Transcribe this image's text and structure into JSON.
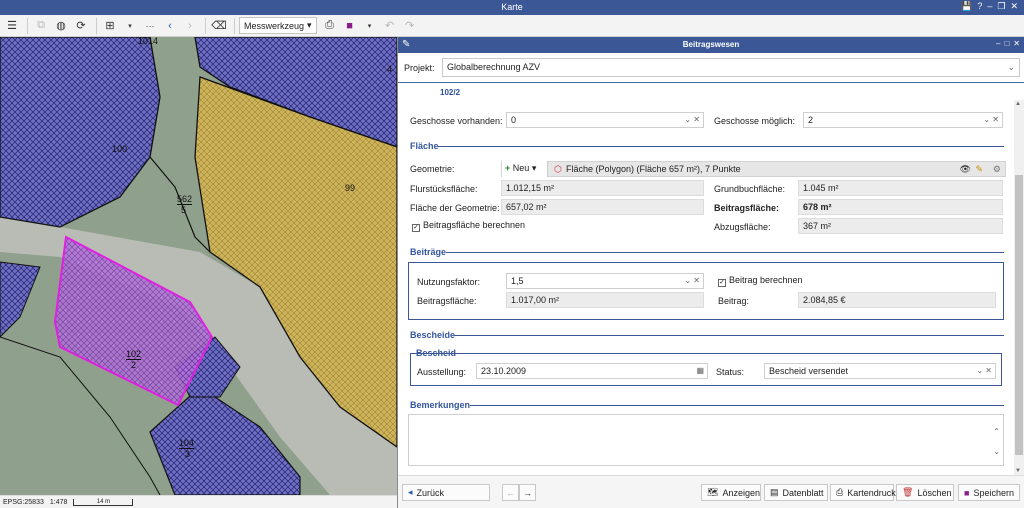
{
  "window": {
    "title": "Karte",
    "controls": [
      "💾",
      "?",
      "–",
      "❐",
      "✕"
    ]
  },
  "toolbar": {
    "measure_tool": "Messwerkzeug",
    "more": "···"
  },
  "map": {
    "parcels": [
      {
        "id": "1014",
        "label": "1014"
      },
      {
        "id": "100",
        "label": "100"
      },
      {
        "id": "562-5",
        "label": "562",
        "sub": "5"
      },
      {
        "id": "99",
        "label": "99"
      },
      {
        "id": "102-2",
        "label": "102",
        "sub": "2"
      },
      {
        "id": "104-3",
        "label": "104",
        "sub": "3"
      },
      {
        "id": "4",
        "label": "4"
      }
    ]
  },
  "statusbar": {
    "crs": "EPSG:25833",
    "scale": "1:478",
    "scalebar": "14 m"
  },
  "panel": {
    "title": "Beitragswesen",
    "project_label": "Projekt:",
    "project_value": "Globalberechnung AZV",
    "tab": "102/2",
    "geschosse_vorhanden_label": "Geschosse vorhanden:",
    "geschosse_vorhanden_value": "0",
    "geschosse_moeglich_label": "Geschosse möglich:",
    "geschosse_moeglich_value": "2",
    "flaeche": {
      "title": "Fläche",
      "geometrie_label": "Geometrie:",
      "new_label": "Neu",
      "geometrie_value": "Fläche (Polygon) (Fläche 657 m²), 7 Punkte",
      "flurstueck_label": "Flurstücksfläche:",
      "flurstueck_value": "1.012,15 m²",
      "grundbuch_label": "Grundbuchfläche:",
      "grundbuch_value": "1.045 m²",
      "geom_flaeche_label": "Fläche der Geometrie:",
      "geom_flaeche_value": "657,02 m²",
      "beitragsflaeche_label": "Beitragsfläche:",
      "beitragsflaeche_value": "678 m²",
      "berechnen_label": "Beitragsfläche berechnen",
      "abzug_label": "Abzugsfläche:",
      "abzug_value": "367 m²"
    },
    "beitraege": {
      "title": "Beiträge",
      "nutzungsfaktor_label": "Nutzungsfaktor:",
      "nutzungsfaktor_value": "1,5",
      "beitrag_berechnen_label": "Beitrag berechnen",
      "beitragsflaeche_label": "Beitragsfläche:",
      "beitragsflaeche_value": "1.017,00 m²",
      "beitrag_label": "Beitrag:",
      "beitrag_value": "2.084,85 €"
    },
    "bescheide": {
      "title": "Bescheide",
      "sub_title": "Bescheid",
      "ausstellung_label": "Ausstellung:",
      "ausstellung_value": "23.10.2009",
      "status_label": "Status:",
      "status_value": "Bescheid versendet"
    },
    "bemerkungen": {
      "title": "Bemerkungen"
    },
    "footer": {
      "back": "Zurück",
      "anzeigen": "Anzeigen",
      "datenblatt": "Datenblatt",
      "kartendruck": "Kartendruck",
      "loeschen": "Löschen",
      "speichern": "Speichern"
    }
  },
  "colors": {
    "accent": "#3b5796",
    "selection": "#e040e0",
    "parcel_blue": "#3a3aa0",
    "parcel_yellow": "#c8b040"
  }
}
